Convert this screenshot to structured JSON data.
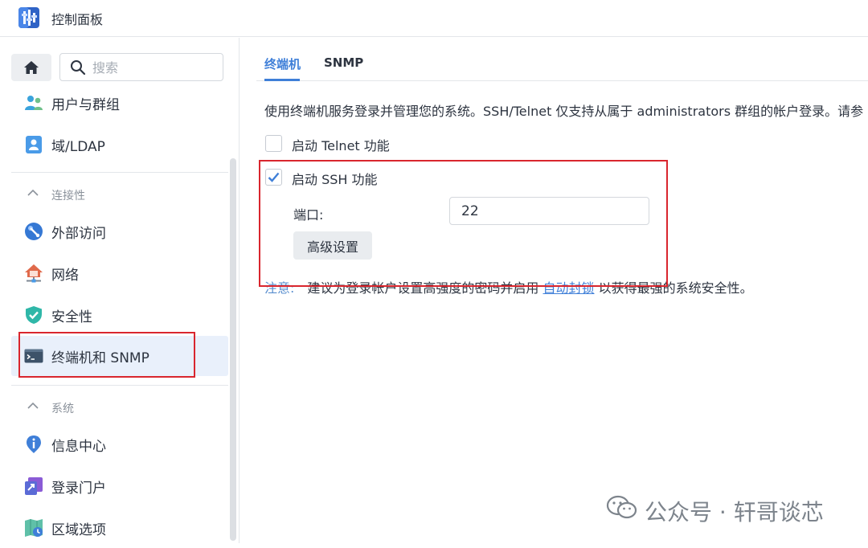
{
  "app": {
    "title": "控制面板"
  },
  "search": {
    "placeholder": "搜索"
  },
  "sidebar": {
    "items": [
      {
        "label": "用户与群组",
        "icon": "users-icon"
      },
      {
        "label": "域/LDAP",
        "icon": "domain-ldap-icon"
      },
      {
        "label": "外部访问",
        "icon": "external-access-icon"
      },
      {
        "label": "网络",
        "icon": "network-icon"
      },
      {
        "label": "安全性",
        "icon": "security-shield-icon"
      },
      {
        "label": "终端机和 SNMP",
        "icon": "terminal-icon",
        "active": true
      },
      {
        "label": "信息中心",
        "icon": "info-center-icon"
      },
      {
        "label": "登录门户",
        "icon": "login-portal-icon"
      },
      {
        "label": "区域选项",
        "icon": "regional-options-icon"
      }
    ],
    "sections": [
      {
        "label": "连接性"
      },
      {
        "label": "系统"
      }
    ]
  },
  "tabs": [
    {
      "label": "终端机",
      "active": true
    },
    {
      "label": "SNMP",
      "active": false
    }
  ],
  "main": {
    "description": "使用终端机服务登录并管理您的系统。SSH/Telnet 仅支持从属于 administrators 群组的帐户登录。请参",
    "telnet": {
      "label": "启动 Telnet 功能",
      "checked": false
    },
    "ssh": {
      "label": "启动 SSH 功能",
      "checked": true
    },
    "port": {
      "label": "端口:",
      "value": "22"
    },
    "advanced_button": "高级设置",
    "note": {
      "prefix": "注意:",
      "text_before": "建议为登录帐户设置高强度的密码并启用 ",
      "link": "自动封锁",
      "text_after": " 以获得最强的系统安全性。"
    }
  },
  "watermark": {
    "text": "公众号 · 轩哥谈芯"
  },
  "colors": {
    "accent": "#3f7fd8",
    "highlight": "#d9262e",
    "active_bg": "#e9f0fb"
  }
}
